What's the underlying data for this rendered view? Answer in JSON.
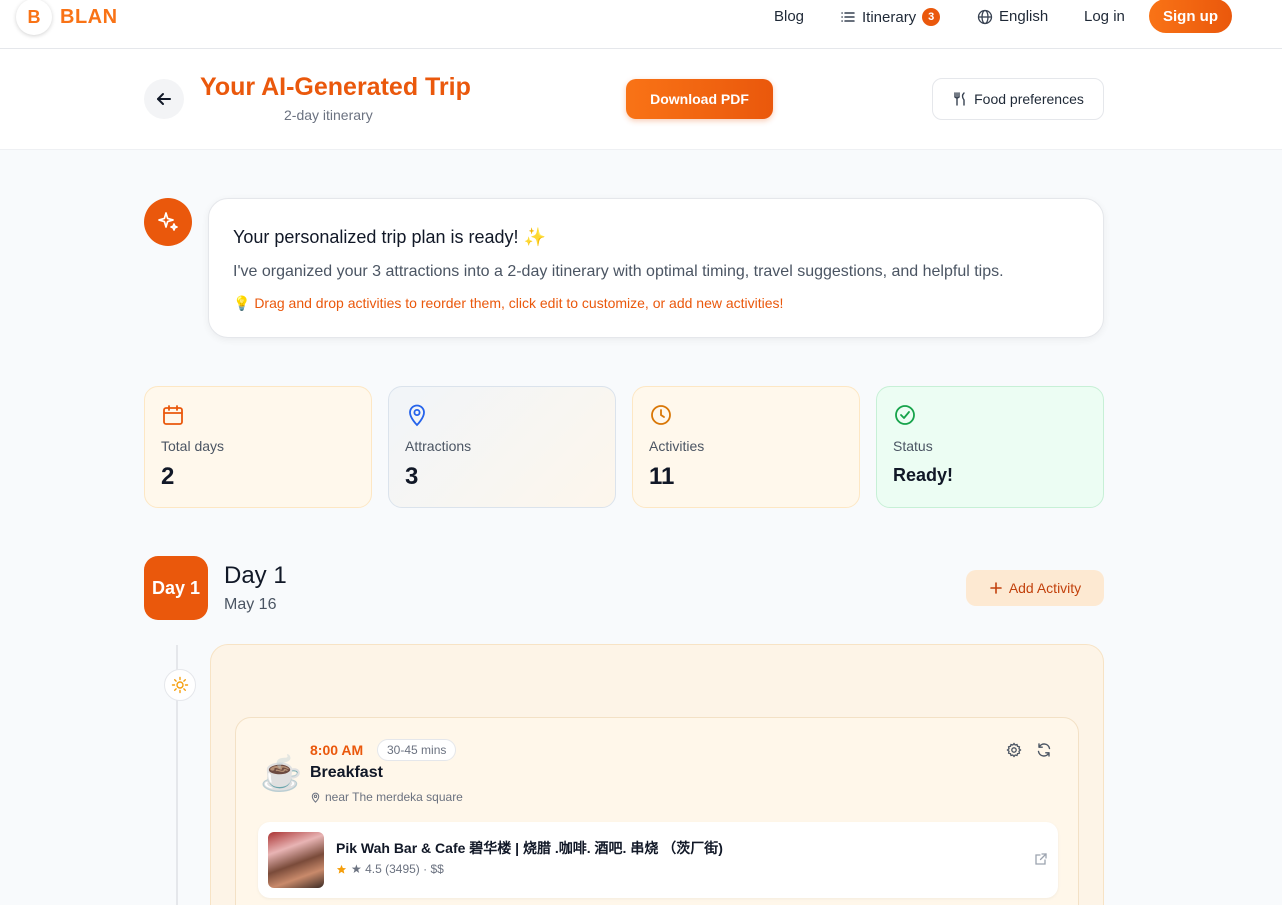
{
  "nav": {
    "logo_letter": "B",
    "logo_text": "BLAN",
    "blog": "Blog",
    "itinerary": "Itinerary",
    "itinerary_count": "3",
    "language": "English",
    "login": "Log in",
    "signup": "Sign up"
  },
  "header": {
    "title": "Your AI-Generated Trip",
    "subtitle": "2-day itinerary",
    "download": "Download PDF",
    "food_prefs": "Food preferences"
  },
  "message": {
    "title": "Your personalized trip plan is ready! ✨",
    "body": "I've organized your 3 attractions into a 2-day itinerary with optimal timing, travel suggestions, and helpful tips.",
    "tip": "💡 Drag and drop activities to reorder them, click edit to customize, or add new activities!"
  },
  "stats": [
    {
      "label": "Total days",
      "value": "2",
      "icon": "calendar-icon"
    },
    {
      "label": "Attractions",
      "value": "3",
      "icon": "map-pin-icon"
    },
    {
      "label": "Activities",
      "value": "11",
      "icon": "clock-icon"
    },
    {
      "label": "Status",
      "value": "Ready!",
      "icon": "check-circle-icon"
    }
  ],
  "day": {
    "badge": "Day 1",
    "title": "Day 1",
    "date": "May 16",
    "add_activity": "Add Activity"
  },
  "activity": {
    "emoji": "☕",
    "time": "8:00 AM",
    "duration": "30-45 mins",
    "name": "Breakfast",
    "location": "near The merdeka square",
    "place": {
      "name": "Pik Wah Bar & Cafe 碧华楼 | 烧腊 .咖啡. 酒吧. 串烧 （茨厂街)",
      "rating": "★ 4.5 (3495) · $$"
    }
  },
  "colors": {
    "accent": "#ea580c",
    "accent_light": "#f97316"
  }
}
